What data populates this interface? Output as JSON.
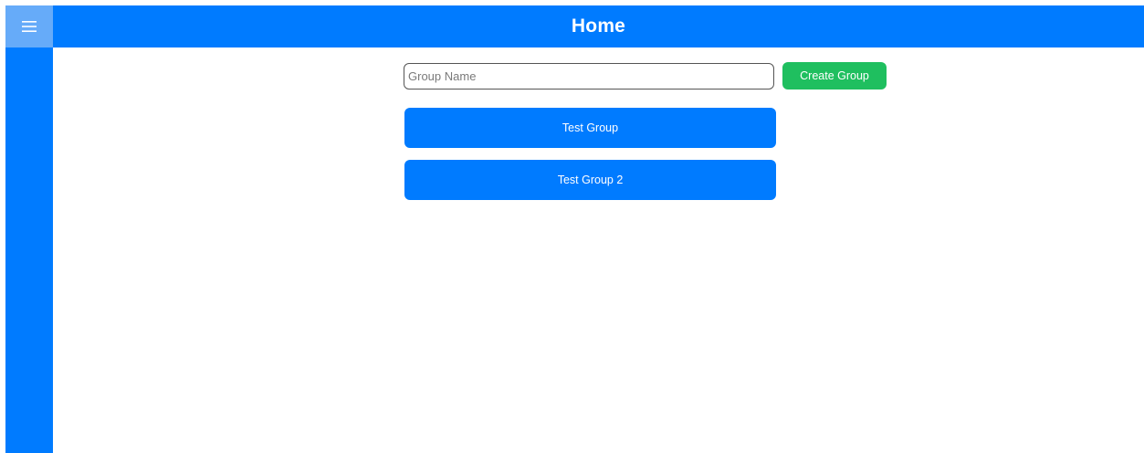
{
  "header": {
    "title": "Home"
  },
  "sidebar": {
    "menu_icon": "hamburger-menu-icon"
  },
  "create_group": {
    "input_value": "",
    "input_placeholder": "Group Name",
    "button_label": "Create Group"
  },
  "groups": [
    {
      "label": "Test Group"
    },
    {
      "label": "Test Group 2"
    }
  ],
  "colors": {
    "primary": "#007bff",
    "menu_toggle": "#66abf9",
    "success": "#1fbf5f",
    "background": "#ffffff"
  }
}
